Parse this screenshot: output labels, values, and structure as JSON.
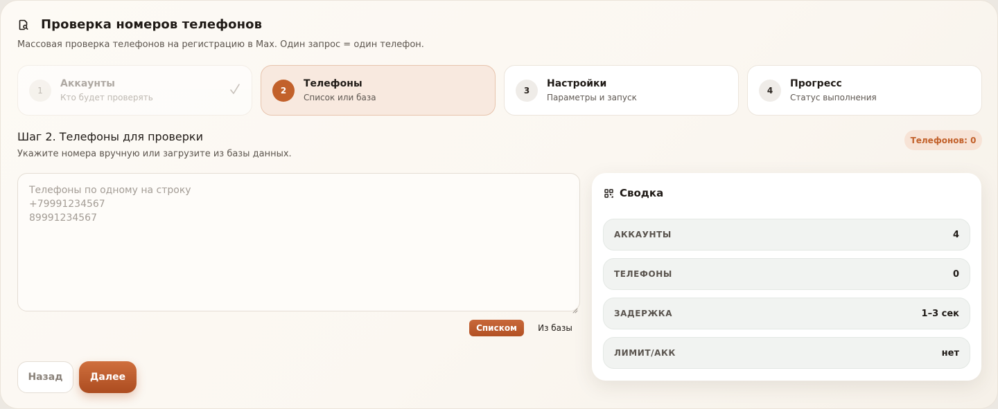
{
  "header": {
    "title": "Проверка номеров телефонов",
    "subtitle": "Массовая проверка телефонов на регистрацию в Max. Один запрос = один телефон.",
    "icon": "document-search-icon"
  },
  "steps": [
    {
      "number": "1",
      "title": "Аккаунты",
      "subtitle": "Кто будет проверять",
      "state": "done"
    },
    {
      "number": "2",
      "title": "Телефоны",
      "subtitle": "Список или база",
      "state": "active"
    },
    {
      "number": "3",
      "title": "Настройки",
      "subtitle": "Параметры и запуск",
      "state": "pending"
    },
    {
      "number": "4",
      "title": "Прогресс",
      "subtitle": "Статус выполнения",
      "state": "pending"
    }
  ],
  "section": {
    "title": "Шаг 2. Телефоны для проверки",
    "subtitle": "Укажите номера вручную или загрузите из базы данных.",
    "badge": "Телефонов: 0"
  },
  "phones_input": {
    "value": "",
    "placeholder": "Телефоны по одному на строку\n+79991234567\n89991234567"
  },
  "source_mode": {
    "list_label": "Списком",
    "db_label": "Из базы",
    "selected": "Списком"
  },
  "nav": {
    "back_label": "Назад",
    "next_label": "Далее"
  },
  "summary": {
    "title": "Сводка",
    "icon": "grid-icon",
    "rows": [
      {
        "label": "АККАУНТЫ",
        "value": "4"
      },
      {
        "label": "ТЕЛЕФОНЫ",
        "value": "0"
      },
      {
        "label": "ЗАДЕРЖКА",
        "value": "1–3 сек"
      },
      {
        "label": "ЛИМИТ/АКК",
        "value": "нет"
      }
    ]
  },
  "colors": {
    "accent": "#c2612b",
    "accent_soft": "#f8e9df",
    "background": "#fbf7f1"
  }
}
